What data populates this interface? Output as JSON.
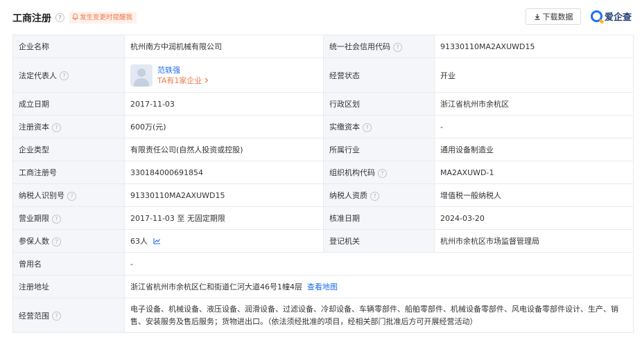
{
  "header": {
    "title": "工商注册",
    "alert_label": "发生变更时提醒我",
    "download_label": "下载数据",
    "brand": "爱企查",
    "accent": "#1e6bf0",
    "alert_color": "#f07847"
  },
  "labels": {
    "company_name": "企业名称",
    "credit_code": "统一社会信用代码",
    "legal_rep": "法定代表人",
    "status": "经营状态",
    "founded": "成立日期",
    "region": "行政区划",
    "reg_capital": "注册资本",
    "paid_capital": "实缴资本",
    "company_type": "企业类型",
    "industry": "所属行业",
    "reg_no": "工商注册号",
    "org_code": "组织机构代码",
    "taxpayer_id": "纳税人识别号",
    "taxpayer_qual": "纳税人资质",
    "term": "营业期限",
    "approve_date": "核准日期",
    "insured": "参保人数",
    "authority": "登记机关",
    "former_name": "曾用名",
    "address": "注册地址",
    "scope": "经营范围"
  },
  "values": {
    "company_name": "杭州南方中润机械有限公司",
    "credit_code": "91330110MA2AXUWD15",
    "legal_rep_name": "范轶强",
    "legal_rep_companies": "TA有1家企业",
    "status": "开业",
    "founded": "2017-11-03",
    "region": "浙江省杭州市余杭区",
    "reg_capital": "600万(元)",
    "paid_capital": "-",
    "company_type": "有限责任公司(自然人投资或控股)",
    "industry": "通用设备制造业",
    "reg_no": "330184000691854",
    "org_code": "MA2AXUWD-1",
    "taxpayer_id": "91330110MA2AXUWD15",
    "taxpayer_qual": "增值税一般纳税人",
    "term": "2017-11-03 至 无固定期限",
    "approve_date": "2024-03-20",
    "insured": "63人",
    "authority": "杭州市余杭区市场监督管理局",
    "former_name": "-",
    "address": "浙江省杭州市余杭区仁和街道仁河大道46号1幢4层",
    "map_link": "查看地图",
    "scope": "电子设备、机械设备、液压设备、润滑设备、过滤设备、冷却设备、车辆零部件、船舶零部件、机械设备零部件、风电设备零部件设计、生产、销售、安装服务及售后服务；货物进出口。（依法须经批准的项目，经相关部门批准后方可开展经营活动）"
  },
  "icons": {
    "help": "help-circle-icon",
    "bell": "bell-icon",
    "download": "download-icon",
    "trend": "trend-chart-icon",
    "chevron": "chevron-right-icon"
  }
}
